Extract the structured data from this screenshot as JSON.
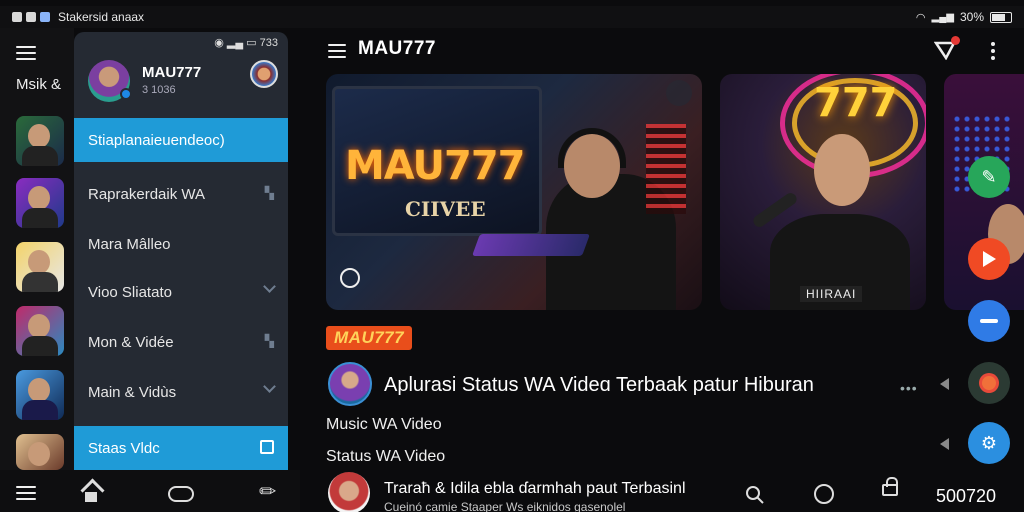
{
  "status_bar": {
    "left_text": "Stakersid anaax",
    "battery_text": "30%"
  },
  "rail": {
    "title": "Msik &"
  },
  "drawer": {
    "profile_name": "MAU777",
    "profile_sub": "3 1036",
    "header_status": "733",
    "items": [
      {
        "label": "Stiaplanaieuendeoc)"
      },
      {
        "label": "Raprakerdaik WA",
        "trailing": "plus"
      },
      {
        "label": "Mara Mâlleo"
      },
      {
        "label": "Vioo Sliatato",
        "trailing": "chevron"
      },
      {
        "label": "Mon & Vidée",
        "trailing": "plus"
      },
      {
        "label": "Main & Vidùs",
        "trailing": "chevron"
      },
      {
        "label": "Staas Vldc",
        "trailing": "gift"
      }
    ]
  },
  "appbar": {
    "title": "MAU777"
  },
  "cards": {
    "card1_brand": "MAU777",
    "card1_sub": "CIIVEE",
    "card2_neon": "777",
    "card2_label": "HIIRAAI"
  },
  "video": {
    "brand_tag": "MAU777",
    "title": "Aplurasi Status WA Videɑ Terbaak patur Hiburan",
    "line1": "Music WA Video",
    "line2": "Status WA Video",
    "next_title": "Traraħ & Idila ebla ɗarmhah paut Terbasinl",
    "next_sub": "Cueinó camie  Staaper  Ws  eiknidos gasenolel",
    "count": "500720"
  },
  "icons": {
    "fab_green": "ticket-icon",
    "fab_red": "play-icon",
    "fab_blue": "minus-icon",
    "fab_dark": "flower-icon",
    "fab_gear": "gear-icon"
  },
  "colors": {
    "accent": "#1f9bd7",
    "brand_orange": "#e94e1b",
    "brand_yellow": "#ffd35a",
    "fab_green": "#27a65a",
    "fab_red": "#f04a24",
    "fab_blue": "#2f7be6",
    "fab_gear": "#2b8fe0"
  }
}
